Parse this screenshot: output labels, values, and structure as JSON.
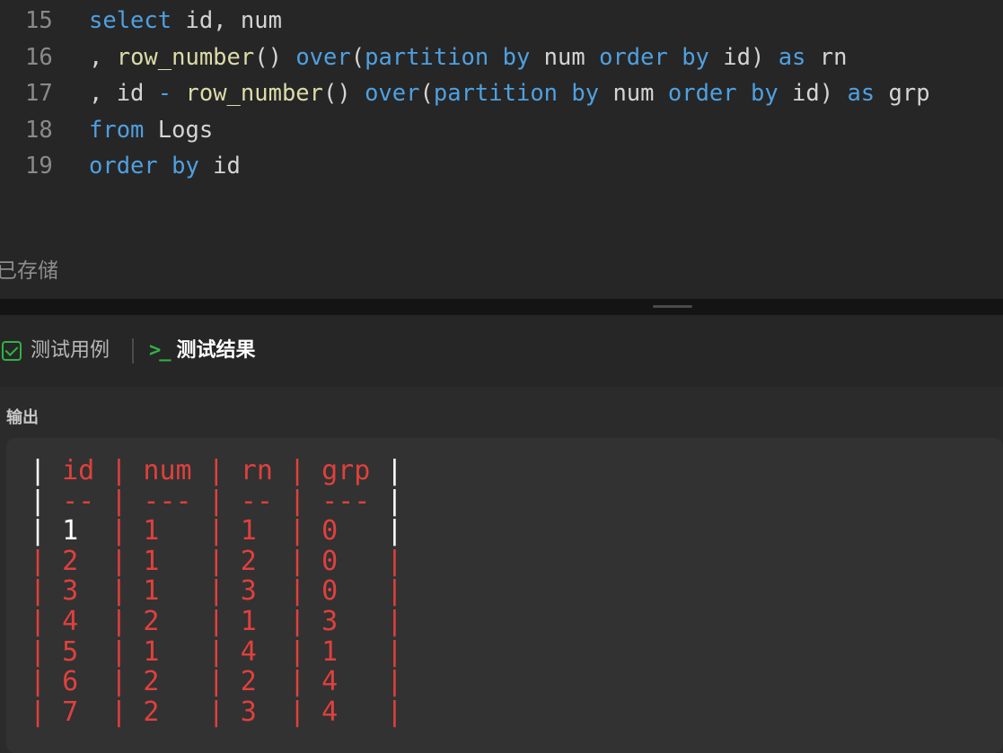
{
  "editor": {
    "lines": [
      {
        "number": "15",
        "tokens": [
          {
            "t": "select",
            "c": "kw"
          },
          {
            "t": " id, num",
            "c": "pl"
          }
        ]
      },
      {
        "number": "16",
        "tokens": [
          {
            "t": ", ",
            "c": "pl"
          },
          {
            "t": "row_number",
            "c": "fn"
          },
          {
            "t": "() ",
            "c": "pl"
          },
          {
            "t": "over",
            "c": "kw"
          },
          {
            "t": "(",
            "c": "pl"
          },
          {
            "t": "partition by",
            "c": "kw"
          },
          {
            "t": " num ",
            "c": "pl"
          },
          {
            "t": "order by",
            "c": "kw"
          },
          {
            "t": " id) ",
            "c": "pl"
          },
          {
            "t": "as",
            "c": "kw"
          },
          {
            "t": " rn",
            "c": "pl"
          }
        ]
      },
      {
        "number": "17",
        "tokens": [
          {
            "t": ", id ",
            "c": "pl"
          },
          {
            "t": "-",
            "c": "kw"
          },
          {
            "t": " ",
            "c": "pl"
          },
          {
            "t": "row_number",
            "c": "fn"
          },
          {
            "t": "() ",
            "c": "pl"
          },
          {
            "t": "over",
            "c": "kw"
          },
          {
            "t": "(",
            "c": "pl"
          },
          {
            "t": "partition by",
            "c": "kw"
          },
          {
            "t": " num ",
            "c": "pl"
          },
          {
            "t": "order by",
            "c": "kw"
          },
          {
            "t": " id) ",
            "c": "pl"
          },
          {
            "t": "as",
            "c": "kw"
          },
          {
            "t": " grp",
            "c": "pl"
          }
        ]
      },
      {
        "number": "18",
        "tokens": [
          {
            "t": "from",
            "c": "kw"
          },
          {
            "t": " Logs",
            "c": "pl"
          }
        ]
      },
      {
        "number": "19",
        "tokens": [
          {
            "t": "order by",
            "c": "kw"
          },
          {
            "t": " id",
            "c": "pl"
          }
        ]
      }
    ],
    "saved_status": "已存储"
  },
  "tabs": {
    "testcases_label": "测试用例",
    "results_label": "测试结果",
    "testcases_icon": "check-box-icon",
    "results_icon": "terminal-icon"
  },
  "output": {
    "label": "输出",
    "table_lines": [
      {
        "kind": "header",
        "cells": [
          "id",
          "num",
          "rn",
          "grp"
        ]
      },
      {
        "kind": "sep",
        "cells": [
          "--",
          "---",
          "--",
          "---"
        ]
      },
      {
        "kind": "row-white",
        "cells": [
          "1",
          "1",
          "1",
          "0"
        ]
      },
      {
        "kind": "row-red",
        "cells": [
          "2",
          "1",
          "2",
          "0"
        ]
      },
      {
        "kind": "row-red",
        "cells": [
          "3",
          "1",
          "3",
          "0"
        ]
      },
      {
        "kind": "row-red",
        "cells": [
          "4",
          "2",
          "1",
          "3"
        ]
      },
      {
        "kind": "row-red",
        "cells": [
          "5",
          "1",
          "4",
          "1"
        ]
      },
      {
        "kind": "row-red",
        "cells": [
          "6",
          "2",
          "2",
          "4"
        ]
      },
      {
        "kind": "row-red",
        "cells": [
          "7",
          "2",
          "3",
          "4"
        ]
      }
    ]
  },
  "colors": {
    "keyword": "#4fa0e0",
    "function": "#dcdcaa",
    "plain": "#d4d4d4",
    "accent_green": "#2fb344",
    "output_red": "#e0403d"
  }
}
